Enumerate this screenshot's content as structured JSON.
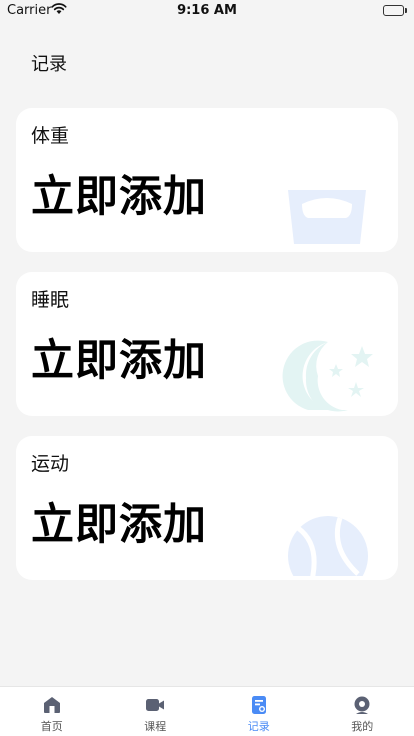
{
  "status_bar": {
    "carrier": "Carrier",
    "time": "9:16 AM"
  },
  "header": {
    "title": "记录"
  },
  "cards": [
    {
      "title": "体重",
      "action": "立即添加",
      "icon": "scale-icon",
      "color": "#e6eefc"
    },
    {
      "title": "睡眠",
      "action": "立即添加",
      "icon": "moon-stars-icon",
      "color": "#e3f4f3"
    },
    {
      "title": "运动",
      "action": "立即添加",
      "icon": "ball-icon",
      "color": "#e6eefc"
    }
  ],
  "tab_bar": {
    "tabs": [
      {
        "label": "首页",
        "icon": "home-icon",
        "active": false
      },
      {
        "label": "课程",
        "icon": "video-icon",
        "active": false
      },
      {
        "label": "记录",
        "icon": "record-icon",
        "active": true
      },
      {
        "label": "我的",
        "icon": "profile-icon",
        "active": false
      }
    ],
    "active_color": "#4a8bf5",
    "inactive_color": "#555555"
  }
}
